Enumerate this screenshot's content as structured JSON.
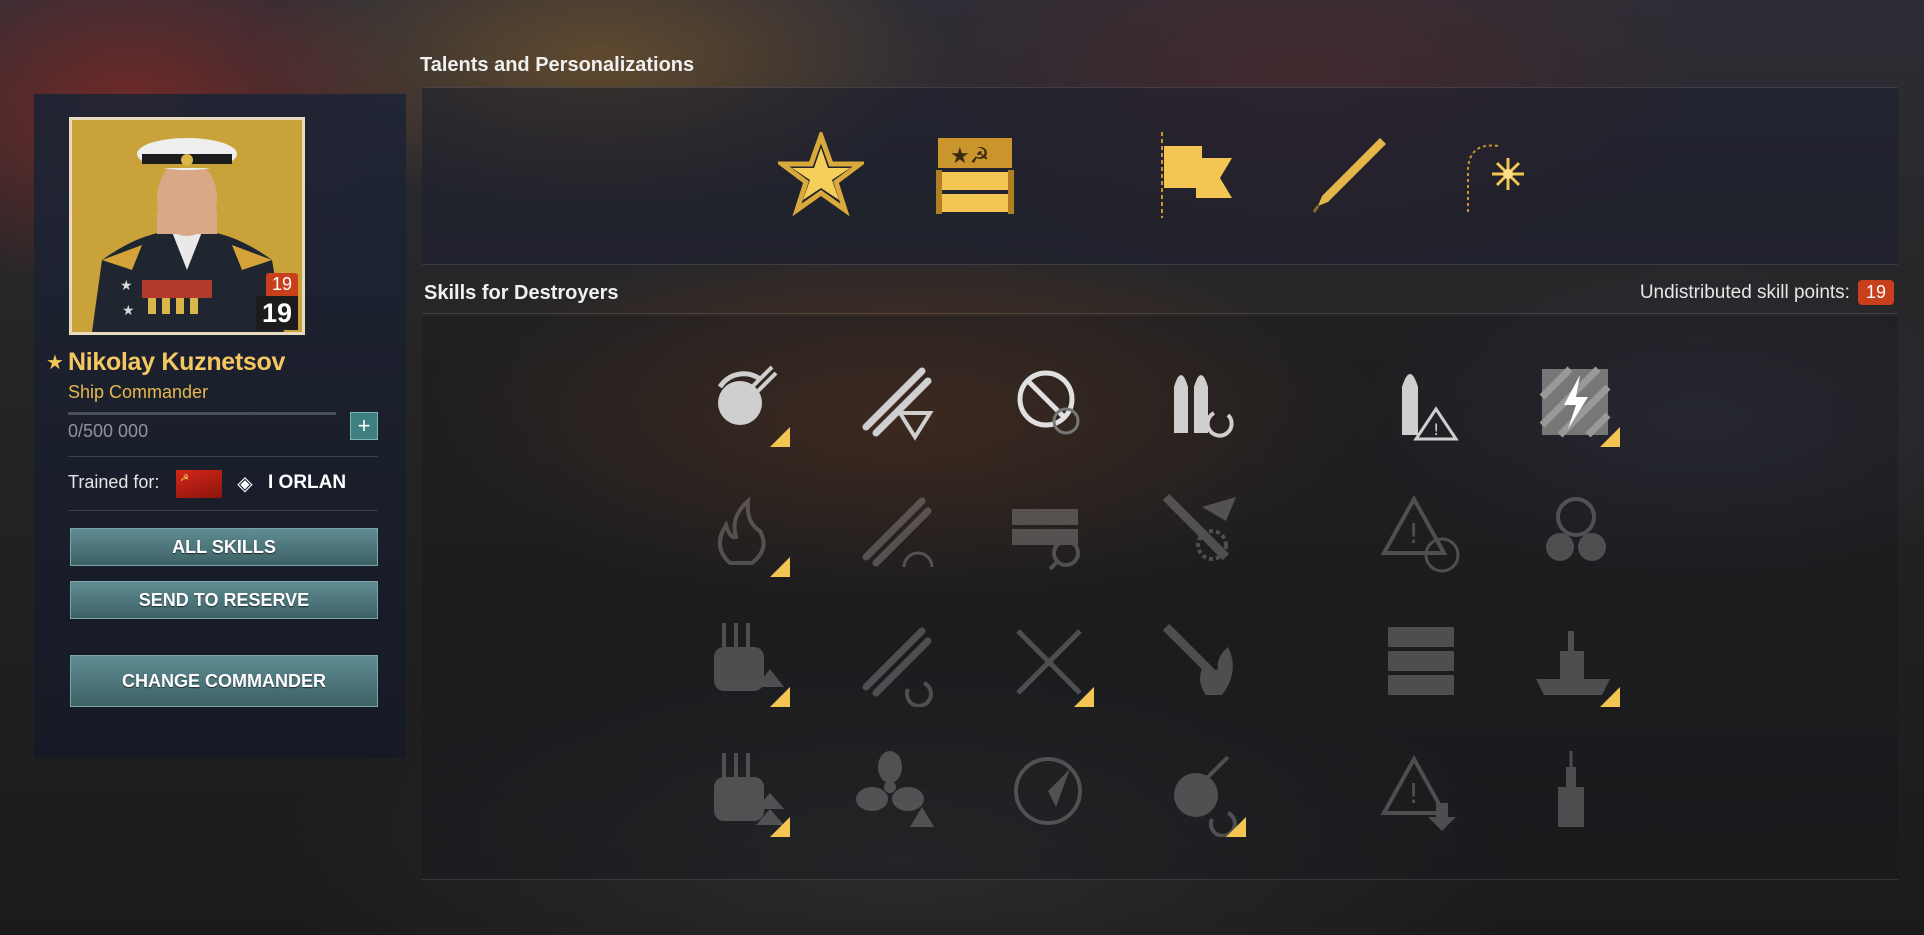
{
  "commander": {
    "name": "Nikolay Kuznetsov",
    "role": "Ship Commander",
    "xp": "0/500 000",
    "level": "19",
    "skill_points_badge": "19",
    "trained_label": "Trained for:",
    "trained_ship": "I ORLAN",
    "nation_icon": "ussr-flag-icon",
    "class_icon": "destroyer-class-icon"
  },
  "buttons": {
    "all_skills": "ALL SKILLS",
    "send_to_reserve": "SEND TO RESERVE",
    "change_commander": "CHANGE COMMANDER",
    "xp_plus": "+"
  },
  "talents": {
    "title": "Talents and Personalizations",
    "items": [
      {
        "icon": "star-wreath-icon"
      },
      {
        "icon": "ussr-ammo-crate-icon"
      },
      {
        "icon": "flag-icon"
      },
      {
        "icon": "pen-icon"
      },
      {
        "icon": "firework-icon"
      }
    ]
  },
  "skills": {
    "title": "Skills for Destroyers",
    "undistributed_label": "Undistributed skill points:",
    "undistributed_value": "19",
    "items": [
      {
        "icon": "turret-reload-icon",
        "state": "available",
        "upgraded": true
      },
      {
        "icon": "torpedo-armament-icon",
        "state": "available",
        "upgraded": false
      },
      {
        "icon": "no-consumable-icon",
        "state": "available",
        "upgraded": false
      },
      {
        "icon": "shell-reload-icon",
        "state": "available",
        "upgraded": false
      },
      {
        "icon": "shell-warning-icon",
        "state": "available",
        "upgraded": false
      },
      {
        "icon": "electric-hazard-icon",
        "state": "available",
        "upgraded": true
      },
      {
        "icon": "fire-icon",
        "state": "locked",
        "upgraded": true
      },
      {
        "icon": "torpedo-speed-icon",
        "state": "locked",
        "upgraded": false
      },
      {
        "icon": "consumable-search-icon",
        "state": "locked",
        "upgraded": false
      },
      {
        "icon": "torpedo-flag-icon",
        "state": "locked",
        "upgraded": false
      },
      {
        "icon": "warning-clock-icon",
        "state": "locked",
        "upgraded": false
      },
      {
        "icon": "helm-propeller-icon",
        "state": "locked",
        "upgraded": false
      },
      {
        "icon": "turret-upgrade-icon",
        "state": "locked",
        "upgraded": true
      },
      {
        "icon": "torpedo-reload-icon",
        "state": "locked",
        "upgraded": false
      },
      {
        "icon": "crossed-swords-icon",
        "state": "locked",
        "upgraded": true
      },
      {
        "icon": "fire-torpedo-icon",
        "state": "locked",
        "upgraded": false
      },
      {
        "icon": "crate-stack-icon",
        "state": "locked",
        "upgraded": false
      },
      {
        "icon": "battleship-icon",
        "state": "locked",
        "upgraded": true
      },
      {
        "icon": "turret-double-upgrade-icon",
        "state": "locked",
        "upgraded": true
      },
      {
        "icon": "propeller-upgrade-icon",
        "state": "locked",
        "upgraded": false
      },
      {
        "icon": "radar-sweep-icon",
        "state": "locked",
        "upgraded": false
      },
      {
        "icon": "turret-traverse-icon",
        "state": "locked",
        "upgraded": true
      },
      {
        "icon": "warning-down-icon",
        "state": "locked",
        "upgraded": false
      },
      {
        "icon": "warship-icon",
        "state": "locked",
        "upgraded": false
      }
    ]
  }
}
